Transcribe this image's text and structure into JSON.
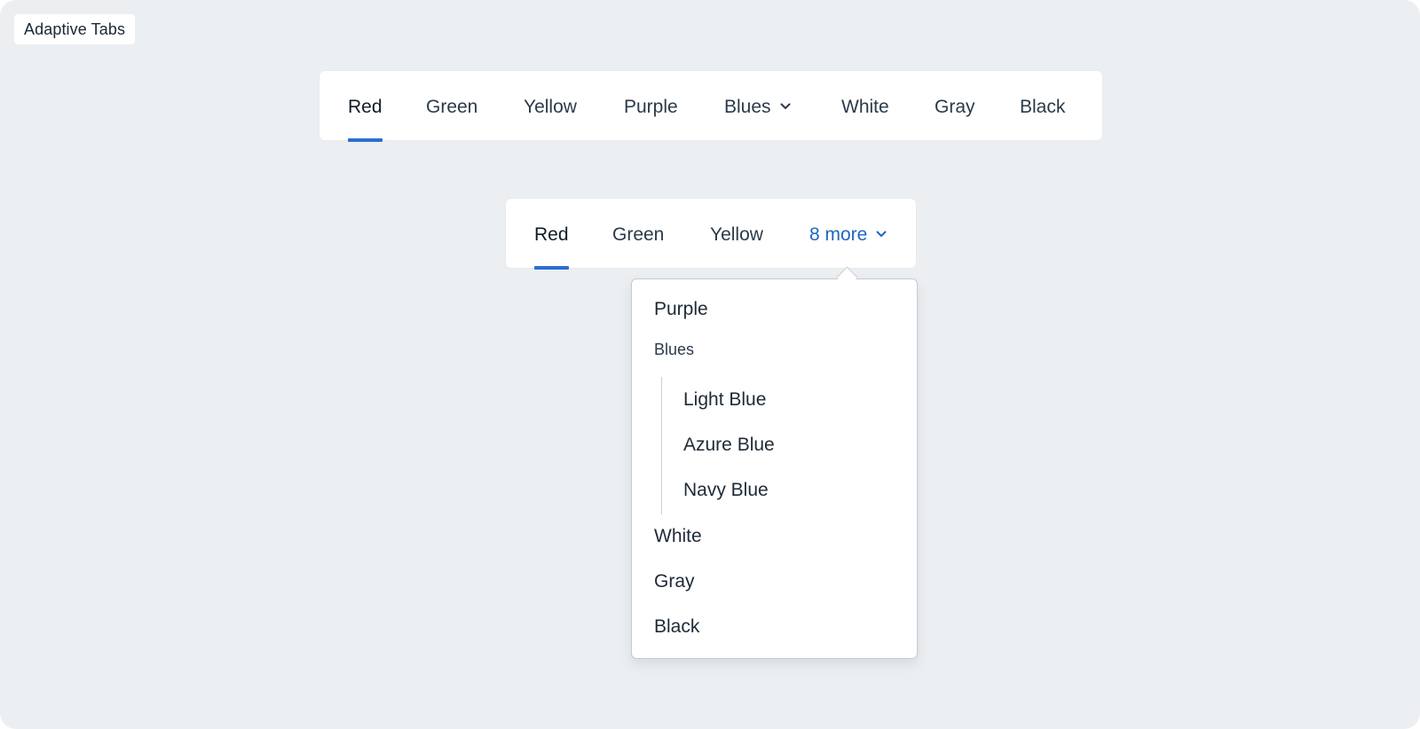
{
  "page_label": "Adaptive Tabs",
  "accent_color": "#2a6fd0",
  "wide_tabs": {
    "tabs": [
      {
        "label": "Red",
        "selected": true
      },
      {
        "label": "Green"
      },
      {
        "label": "Yellow"
      },
      {
        "label": "Purple"
      },
      {
        "label": "Blues",
        "icon": "chevron-down-icon"
      },
      {
        "label": "White"
      },
      {
        "label": "Gray"
      },
      {
        "label": "Black"
      }
    ]
  },
  "narrow_tabs": {
    "tabs": [
      {
        "label": "Red",
        "selected": true
      },
      {
        "label": "Green"
      },
      {
        "label": "Yellow"
      }
    ],
    "more_label": "8 more",
    "more_icon": "chevron-down-icon"
  },
  "overflow_menu": {
    "items": [
      {
        "label": "Purple"
      },
      {
        "group": "Blues",
        "children": [
          "Light Blue",
          "Azure Blue",
          "Navy Blue"
        ]
      },
      {
        "label": "White"
      },
      {
        "label": "Gray"
      },
      {
        "label": "Black"
      }
    ]
  }
}
